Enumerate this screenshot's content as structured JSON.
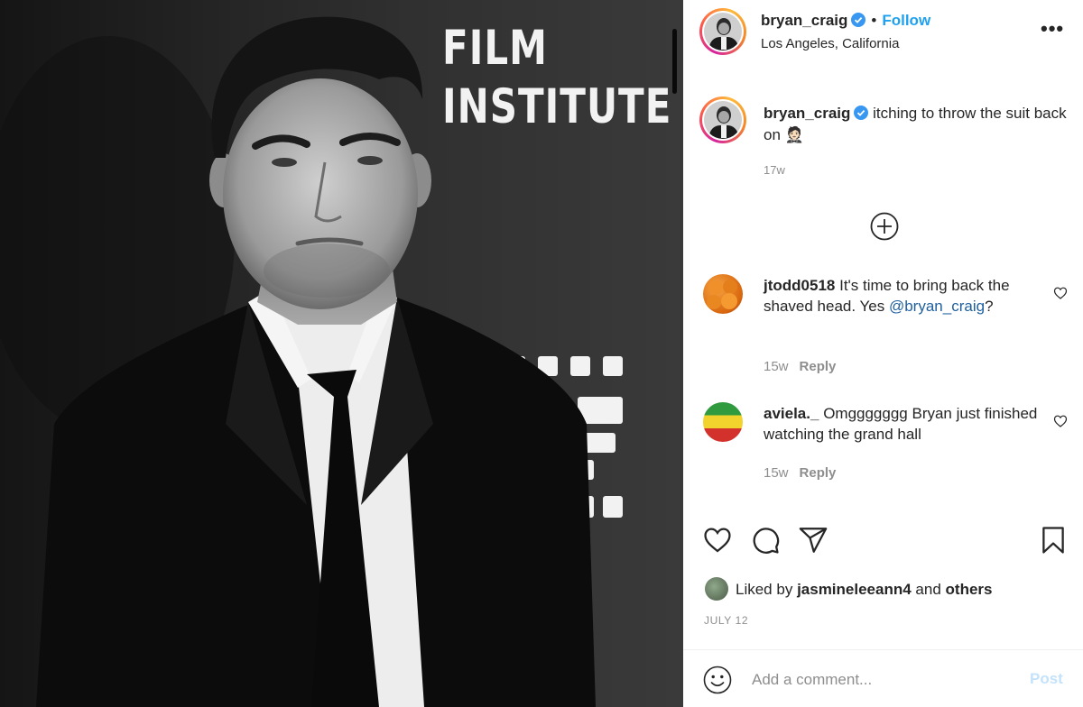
{
  "photo": {
    "sign_line1": "FILM",
    "sign_line2": "INSTITUTE"
  },
  "post": {
    "author": {
      "username": "bryan_craig",
      "verified": true,
      "location": "Los Angeles, California"
    },
    "follow_label": "Follow",
    "more_label": "•••",
    "caption_text": "itching to throw the suit back on",
    "caption_emoji": "🤵🏻",
    "caption_time": "17w",
    "likes": {
      "prefix": "Liked by",
      "user": "jasmineleeann4",
      "and_label": "and",
      "others_label": "others"
    },
    "date": "JULY 12"
  },
  "comments": [
    {
      "username": "jtodd0518",
      "text": "It's time to bring back the shaved head. Yes",
      "mention": "@bryan_craig",
      "suffix": "?",
      "time": "15w",
      "reply_label": "Reply"
    },
    {
      "username": "aviela._",
      "text": "Omggggggg Bryan just finished watching the grand hall",
      "time": "15w",
      "reply_label": "Reply"
    }
  ],
  "comment_box": {
    "placeholder": "Add a comment...",
    "post_label": "Post"
  },
  "icons": {
    "verified": "verified-badge-icon",
    "like": "heart-icon",
    "comment": "comment-bubble-icon",
    "share": "paper-plane-icon",
    "save": "bookmark-icon",
    "more": "ellipsis-icon",
    "load_more": "plus-circle-icon",
    "emoji": "smiley-icon"
  },
  "colors": {
    "link_blue": "#1fa1f1",
    "mention_blue": "#1f5f9e",
    "muted_text": "#8e8e8e",
    "post_disabled": "#c4e3fb",
    "verified_blue": "#3897f0"
  }
}
